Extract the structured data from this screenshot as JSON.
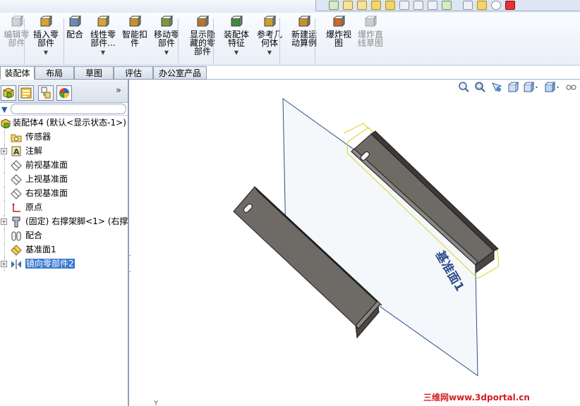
{
  "ribbon": {
    "buttons": [
      {
        "id": "edit-part",
        "label": "编辑零\n部件",
        "disabled": true,
        "caret": false
      },
      {
        "id": "insert-part",
        "label": "插入零\n部件",
        "disabled": false,
        "caret": true
      },
      {
        "id": "mate",
        "label": "配合",
        "disabled": false,
        "caret": false
      },
      {
        "id": "linear-pattern",
        "label": "线性零\n部件...",
        "disabled": false,
        "caret": true
      },
      {
        "id": "smart-fastener",
        "label": "智能扣\n件",
        "disabled": false,
        "caret": false
      },
      {
        "id": "move-component",
        "label": "移动零\n部件",
        "disabled": false,
        "caret": true
      },
      {
        "id": "show-hidden",
        "label": "显示隐\n藏的零\n部件",
        "disabled": false,
        "caret": false
      },
      {
        "id": "assembly-features",
        "label": "装配体\n特征",
        "disabled": false,
        "caret": true
      },
      {
        "id": "reference-geometry",
        "label": "参考几\n何体",
        "disabled": false,
        "caret": true
      },
      {
        "id": "new-motion-study",
        "label": "新建运\n动算例",
        "disabled": false,
        "caret": false
      },
      {
        "id": "exploded-view",
        "label": "爆炸视\n图",
        "disabled": false,
        "caret": false
      },
      {
        "id": "explode-line-sketch",
        "label": "爆炸直\n线草图",
        "disabled": true,
        "caret": false
      }
    ]
  },
  "tabs": [
    "装配体",
    "布局",
    "草图",
    "评估",
    "办公室产品"
  ],
  "active_tab": "装配体",
  "feature_tree": {
    "root": "装配体4  (默认<显示状态-1>)",
    "items": [
      {
        "label": "传感器",
        "icon": "sensor-folder-icon",
        "expand": false
      },
      {
        "label": "注解",
        "icon": "annotation-icon",
        "expand": true
      },
      {
        "label": "前视基准面",
        "icon": "plane-icon",
        "expand": false
      },
      {
        "label": "上视基准面",
        "icon": "plane-icon",
        "expand": false
      },
      {
        "label": "右视基准面",
        "icon": "plane-icon",
        "expand": false
      },
      {
        "label": "原点",
        "icon": "origin-icon",
        "expand": false
      },
      {
        "label": "(固定) 右撑架脚<1> (右撑架",
        "icon": "part-icon",
        "expand": true
      },
      {
        "label": "配合",
        "icon": "mates-icon",
        "expand": false
      },
      {
        "label": "基准面1",
        "icon": "plane-yellow-icon",
        "expand": false
      },
      {
        "label": "镜向零部件2",
        "icon": "mirror-icon",
        "expand": true,
        "selected": true
      }
    ]
  },
  "viewport": {
    "plane_label": "基准面1",
    "triad_label": "Y"
  },
  "watermark": "三维网www.3dportal.cn"
}
